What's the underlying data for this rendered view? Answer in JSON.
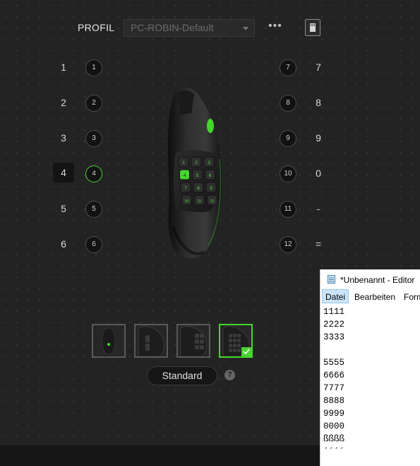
{
  "profile": {
    "label": "PROFIL",
    "selected": "PC-ROBIN-Default",
    "more_label": "•••"
  },
  "left_column": [
    {
      "key": "1",
      "button": "1",
      "active": false
    },
    {
      "key": "2",
      "button": "2",
      "active": false
    },
    {
      "key": "3",
      "button": "3",
      "active": false
    },
    {
      "key": "4",
      "button": "4",
      "active": true
    },
    {
      "key": "5",
      "button": "5",
      "active": false
    },
    {
      "key": "6",
      "button": "6",
      "active": false
    }
  ],
  "right_column": [
    {
      "button": "7",
      "key": "7"
    },
    {
      "button": "8",
      "key": "8"
    },
    {
      "button": "9",
      "key": "9"
    },
    {
      "button": "10",
      "key": "0"
    },
    {
      "button": "11",
      "key": "-"
    },
    {
      "button": "12",
      "key": "="
    }
  ],
  "side_grid_buttons": [
    "1",
    "2",
    "3",
    "4",
    "5",
    "6",
    "7",
    "8",
    "9",
    "10",
    "11",
    "12"
  ],
  "side_plate_views": [
    {
      "name": "top",
      "selected": false
    },
    {
      "name": "side-2-button",
      "selected": false
    },
    {
      "name": "side-6-button",
      "selected": false
    },
    {
      "name": "side-12-button",
      "selected": true
    }
  ],
  "standard_button": "Standard",
  "help_label": "?",
  "colors": {
    "accent": "#44d62c",
    "background": "#232323",
    "dot_grid": "#3a3a3a"
  },
  "notepad": {
    "title": "*Unbenannt - Editor",
    "menu": [
      {
        "label": "Datei",
        "active": true
      },
      {
        "label": "Bearbeiten",
        "active": false
      },
      {
        "label": "Form",
        "active": false
      }
    ],
    "lines": [
      "1111",
      "2222",
      "3333",
      "",
      "5555",
      "6666",
      "7777",
      "8888",
      "9999",
      "0000",
      "ßßßß",
      "´´´´"
    ]
  }
}
